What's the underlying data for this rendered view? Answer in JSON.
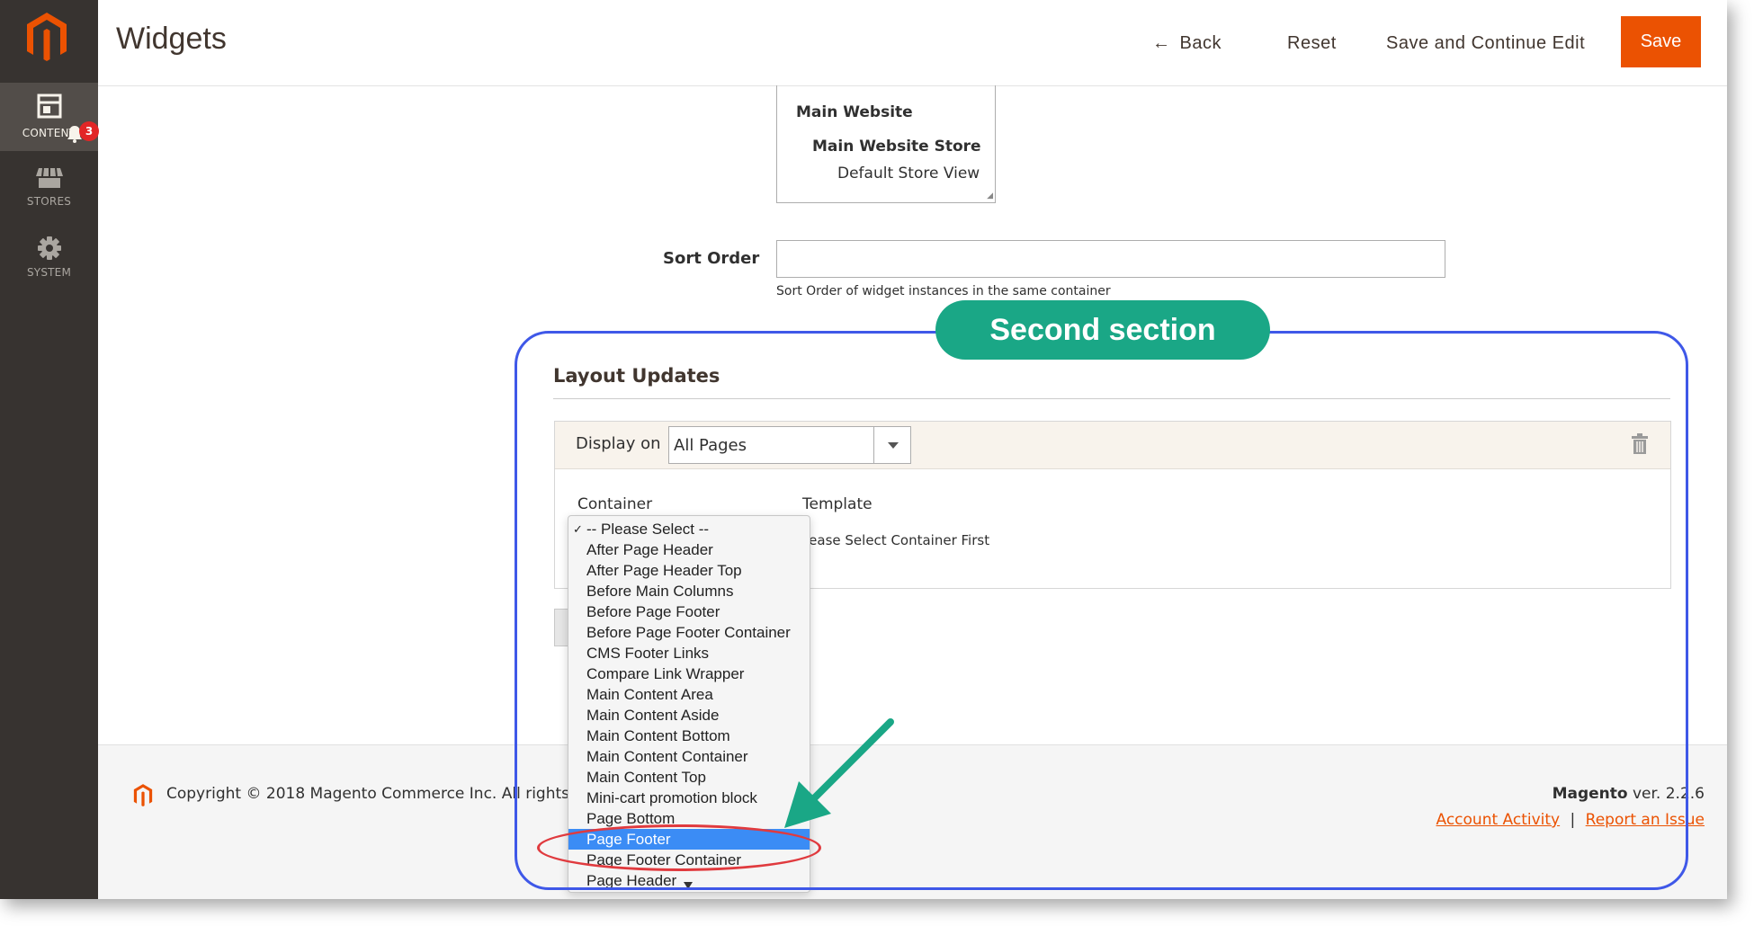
{
  "sidebar": {
    "items": [
      {
        "label": "CONTENT",
        "icon": "layout-icon",
        "active": true,
        "badge": "3"
      },
      {
        "label": "STORES",
        "icon": "store-icon"
      },
      {
        "label": "SYSTEM",
        "icon": "gear-icon"
      }
    ]
  },
  "header": {
    "title": "Widgets",
    "back_label": "Back",
    "reset_label": "Reset",
    "save_continue_label": "Save and Continue Edit",
    "save_label": "Save"
  },
  "store_views": {
    "website": "Main Website",
    "store": "Main Website Store",
    "view": "Default Store View"
  },
  "sort_order": {
    "label": "Sort Order",
    "value": "",
    "note": "Sort Order of widget instances in the same container"
  },
  "layout_updates": {
    "title": "Layout Updates",
    "display_on_label": "Display on",
    "display_on_value": "All Pages",
    "container_label": "Container",
    "template_label": "Template",
    "template_note": "lease Select Container First"
  },
  "dropdown": {
    "options": [
      "-- Please Select --",
      "After Page Header",
      "After Page Header Top",
      "Before Main Columns",
      "Before Page Footer",
      "Before Page Footer Container",
      "CMS Footer Links",
      "Compare Link Wrapper",
      "Main Content Area",
      "Main Content Aside",
      "Main Content Bottom",
      "Main Content Container",
      "Main Content Top",
      "Mini-cart promotion block",
      "Page Bottom",
      "Page Footer",
      "Page Footer Container",
      "Page Header"
    ],
    "checked": "-- Please Select --",
    "highlighted": "Page Footer",
    "check_mark": "✓"
  },
  "footer": {
    "copyright": "Copyright © 2018 Magento Commerce Inc. All rights res",
    "brand": "Magento",
    "version": " ver. 2.2.6",
    "link_account": "Account Activity",
    "separator": "|",
    "link_report": "Report an Issue"
  },
  "annotation": {
    "label": "Second section",
    "colors": {
      "box": "#3f58e8",
      "pill": "#1aa786",
      "ellipse": "#e03a3e",
      "arrow": "#1aa786"
    }
  },
  "colors": {
    "accent": "#eb5202",
    "sidebar": "#373330",
    "selection": "#3b8cf5"
  }
}
